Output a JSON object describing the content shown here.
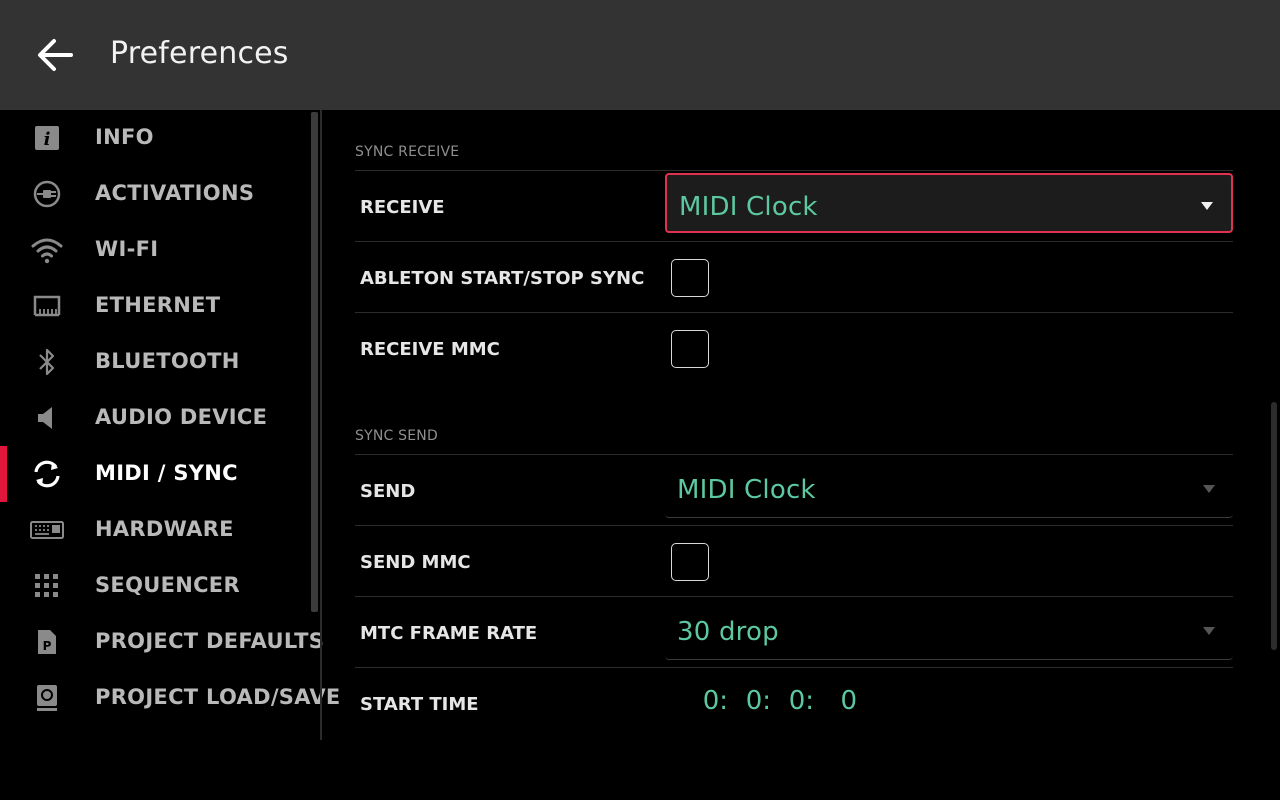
{
  "header": {
    "title": "Preferences",
    "back_icon": "arrow-left-icon"
  },
  "sidebar": {
    "items": [
      {
        "label": "INFO",
        "icon": "info-icon"
      },
      {
        "label": "ACTIVATIONS",
        "icon": "plug-icon"
      },
      {
        "label": "WI-FI",
        "icon": "wifi-icon"
      },
      {
        "label": "ETHERNET",
        "icon": "ethernet-icon"
      },
      {
        "label": "BLUETOOTH",
        "icon": "bluetooth-icon"
      },
      {
        "label": "AUDIO DEVICE",
        "icon": "speaker-icon"
      },
      {
        "label": "MIDI / SYNC",
        "icon": "sync-icon",
        "active": true
      },
      {
        "label": "HARDWARE",
        "icon": "keyboard-icon"
      },
      {
        "label": "SEQUENCER",
        "icon": "grid-icon"
      },
      {
        "label": "PROJECT DEFAULTS",
        "icon": "project-file-icon"
      },
      {
        "label": "PROJECT LOAD/SAVE",
        "icon": "drive-icon"
      }
    ]
  },
  "sync_receive": {
    "section_label": "SYNC RECEIVE",
    "receive": {
      "label": "RECEIVE",
      "value": "MIDI Clock"
    },
    "ableton_sync": {
      "label": "ABLETON START/STOP SYNC",
      "checked": false
    },
    "receive_mmc": {
      "label": "RECEIVE MMC",
      "checked": false
    }
  },
  "sync_send": {
    "section_label": "SYNC SEND",
    "send": {
      "label": "SEND",
      "value": "MIDI Clock"
    },
    "send_mmc": {
      "label": "SEND MMC",
      "checked": false
    },
    "mtc_frame_rate": {
      "label": "MTC FRAME RATE",
      "value": "30 drop"
    },
    "start_time": {
      "label": "START TIME",
      "parts": [
        "0:",
        "0:",
        "0:",
        "0"
      ]
    }
  },
  "colors": {
    "accent": "#e0163c",
    "value_text": "#5cc8a0",
    "header_bg": "#333333"
  }
}
